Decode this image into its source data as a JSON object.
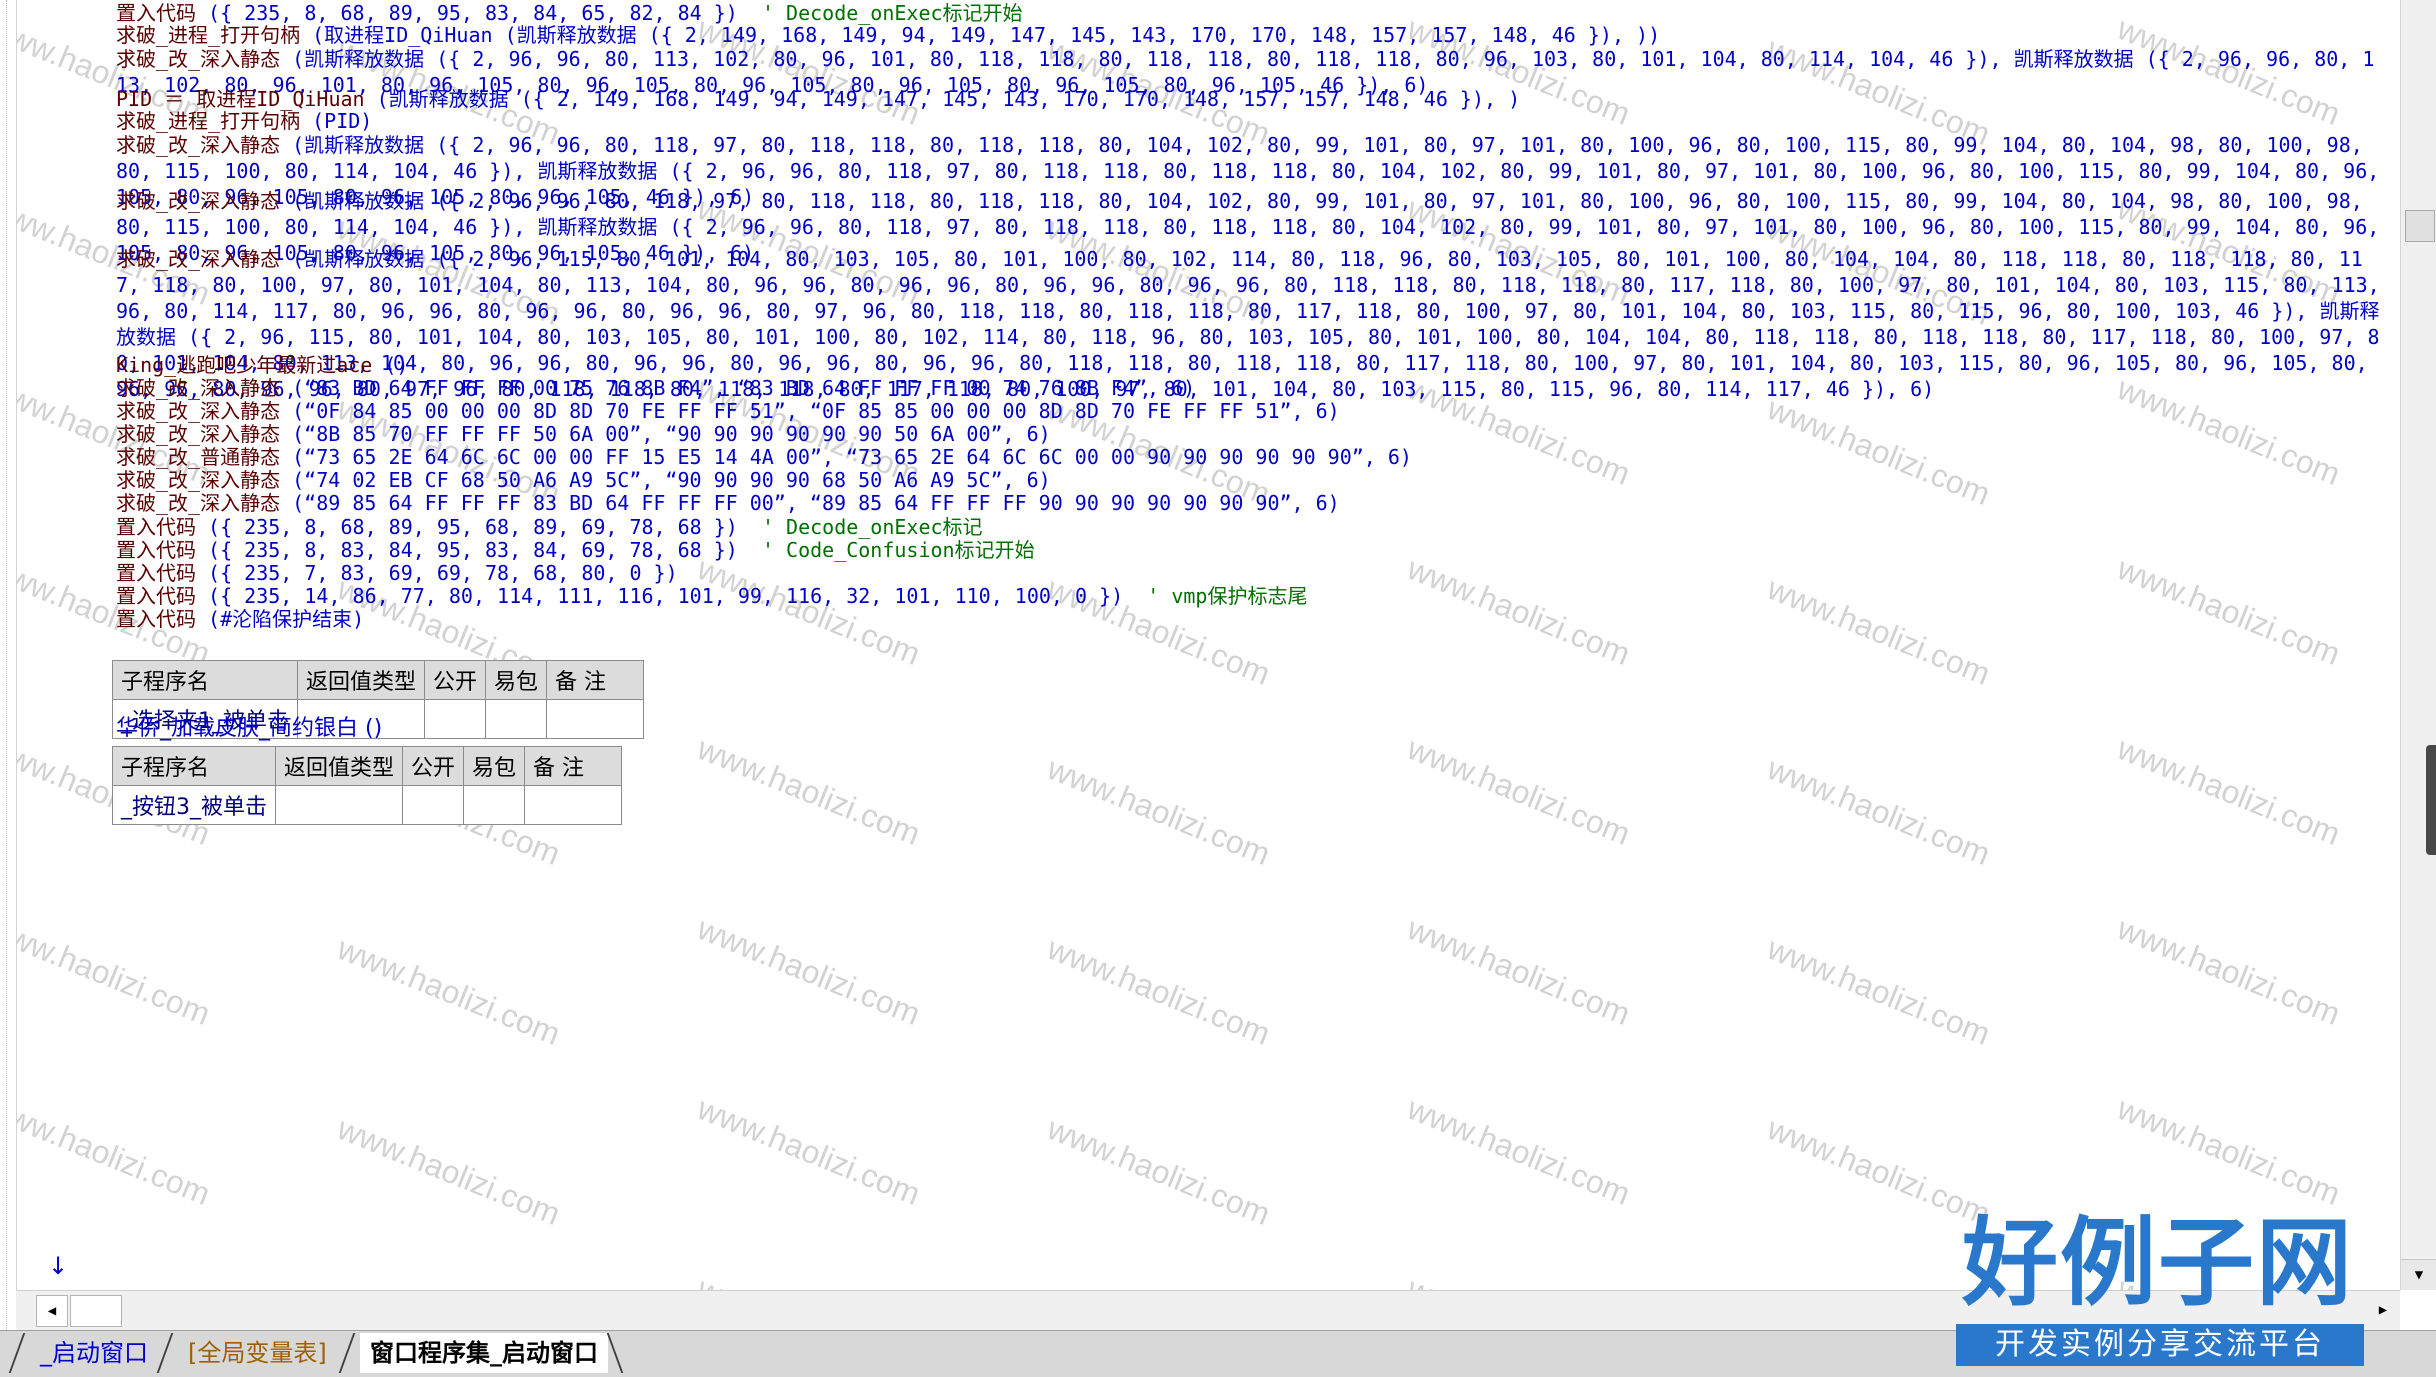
{
  "code_lines": [
    {
      "cmd": "置入代码",
      "args": " ({ 235, 8, 68, 89, 95, 83, 84, 65, 82, 84 })",
      "comment": "  ' Decode_onExec标记开始"
    },
    {
      "cmd": "求破_进程_打开句柄",
      "args": " (取进程ID_QiHuan (凯斯释放数据 ({ 2, 149, 168, 149, 94, 149, 147, 145, 143, 170, 170, 148, 157, 157, 148, 46 }), ))",
      "comment": ""
    },
    {
      "cmd": "求破_改_深入静态",
      "args": " (凯斯释放数据 ({ 2, 96, 96, 80, 113, 102, 80, 96, 101, 80, 118, 118, 80, 118, 118, 80, 118, 118, 80, 96, 103, 80, 101, 104, 80, 114, 104, 46 }), 凯斯释放数据 ({ 2, 96, 96, 80, 113, 102, 80, 96, 101, 80, 96, 105, 80, 96, 105, 80, 96, 105, 80, 96, 105, 80, 96, 105, 80, 96, 105, 46 }), 6)",
      "comment": ""
    },
    {
      "cmd": "PID ＝ 取进程ID_QiHuan",
      "args": " (凯斯释放数据 ({ 2, 149, 168, 149, 94, 149, 147, 145, 143, 170, 170, 148, 157, 157, 148, 46 }), )",
      "comment": ""
    },
    {
      "cmd": "求破_进程_打开句柄",
      "args": " (PID)",
      "comment": ""
    },
    {
      "cmd": "求破_改_深入静态",
      "args": " (凯斯释放数据 ({ 2, 96, 96, 80, 118, 97, 80, 118, 118, 80, 118, 118, 80, 104, 102, 80, 99, 101, 80, 97, 101, 80, 100, 96, 80, 100, 115, 80, 99, 104, 80, 104, 98, 80, 100, 98, 80, 115, 100, 80, 114, 104, 46 }), 凯斯释放数据 ({ 2, 96, 96, 80, 118, 97, 80, 118, 118, 80, 118, 118, 80, 104, 102, 80, 99, 101, 80, 97, 101, 80, 100, 96, 80, 100, 115, 80, 99, 104, 80, 96, 105, 80, 96, 105, 80, 96, 105, 80, 96, 105, 46 }), 6)",
      "comment": ""
    },
    {
      "cmd": "求破_改_深入静态",
      "args": " (凯斯释放数据 ({ 2, 96, 96, 80, 118, 97, 80, 118, 118, 80, 118, 118, 80, 104, 102, 80, 99, 101, 80, 97, 101, 80, 100, 96, 80, 100, 115, 80, 99, 104, 80, 104, 98, 80, 100, 98, 80, 115, 100, 80, 114, 104, 46 }), 凯斯释放数据 ({ 2, 96, 96, 80, 118, 97, 80, 118, 118, 80, 118, 118, 80, 104, 102, 80, 99, 101, 80, 97, 101, 80, 100, 96, 80, 100, 115, 80, 99, 104, 80, 96, 105, 80, 96, 105, 80, 96, 105, 80, 96, 105, 46 }), 6)",
      "comment": ""
    },
    {
      "cmd": "求破_改_深入静态",
      "args": " (凯斯释放数据 ({ 2, 96, 115, 80, 101, 104, 80, 103, 105, 80, 101, 100, 80, 102, 114, 80, 118, 96, 80, 103, 105, 80, 101, 100, 80, 104, 104, 80, 118, 118, 80, 118, 118, 80, 117, 118, 80, 100, 97, 80, 101, 104, 80, 113, 104, 80, 96, 96, 80, 96, 96, 80, 96, 96, 80, 96, 96, 80, 118, 118, 80, 118, 118, 80, 117, 118, 80, 100, 97, 80, 101, 104, 80, 103, 115, 80, 113, 96, 80, 114, 117, 80, 96, 96, 80, 96, 96, 80, 96, 96, 80, 97, 96, 80, 118, 118, 80, 118, 118, 80, 117, 118, 80, 100, 97, 80, 101, 104, 80, 103, 115, 80, 115, 96, 80, 100, 103, 46 }), 凯斯释放数据 ({ 2, 96, 115, 80, 101, 104, 80, 103, 105, 80, 101, 100, 80, 102, 114, 80, 118, 96, 80, 103, 105, 80, 101, 100, 80, 104, 104, 80, 118, 118, 80, 118, 118, 80, 117, 118, 80, 100, 97, 80, 101, 104, 80, 113, 104, 80, 96, 96, 80, 96, 96, 80, 96, 96, 80, 96, 96, 80, 118, 118, 80, 118, 118, 80, 117, 118, 80, 100, 97, 80, 101, 104, 80, 103, 115, 80, 96, 105, 80, 96, 105, 80, 96, 96, 80, 96, 96, 80, 97, 96, 80, 118, 118, 80, 118, 118, 80, 117, 118, 80, 100, 97, 80, 101, 104, 80, 103, 115, 80, 115, 96, 80, 114, 117, 46 }), 6)",
      "comment": ""
    },
    {
      "cmd": "King_逃跑吧少年最新过ace",
      "args": " ()",
      "comment": ""
    },
    {
      "cmd": "求破_改_深入静态",
      "args": " (“83 BD 64 FF FF FF 00 75 76 8B F4”, “83 BD 64 FF FF FF 00 74 76 8B F4”, 6)",
      "comment": ""
    },
    {
      "cmd": "求破_改_深入静态",
      "args": " (“0F 84 85 00 00 00 8D 8D 70 FE FF FF 51”, “0F 85 85 00 00 00 8D 8D 70 FE FF FF 51”, 6)",
      "comment": ""
    },
    {
      "cmd": "求破_改_深入静态",
      "args": " (“8B 85 70 FF FF FF 50 6A 00”, “90 90 90 90 90 90 50 6A 00”, 6)",
      "comment": ""
    },
    {
      "cmd": "求破_改_普通静态",
      "args": " (“73 65 2E 64 6C 6C 00 00 FF 15 E5 14 4A 00”, “73 65 2E 64 6C 6C 00 00 90 90 90 90 90 90”, 6)",
      "comment": ""
    },
    {
      "cmd": "求破_改_深入静态",
      "args": " (“74 02 EB CF 68 50 A6 A9 5C”, “90 90 90 90 68 50 A6 A9 5C”, 6)",
      "comment": ""
    },
    {
      "cmd": "求破_改_深入静态",
      "args": " (“89 85 64 FF FF FF 83 BD 64 FF FF FF 00”, “89 85 64 FF FF FF 90 90 90 90 90 90 90”, 6)",
      "comment": ""
    },
    {
      "cmd": "置入代码",
      "args": " ({ 235, 8, 68, 89, 95, 68, 89, 69, 78, 68 })",
      "comment": "  ' Decode_onExec标记"
    },
    {
      "cmd": "置入代码",
      "args": " ({ 235, 8, 83, 84, 95, 83, 84, 69, 78, 68 })",
      "comment": "  ' Code_Confusion标记开始"
    },
    {
      "cmd": "置入代码",
      "args": " ({ 235, 7, 83, 69, 69, 78, 68, 80, 0 })",
      "comment": ""
    },
    {
      "cmd": "置入代码",
      "args": " ({ 235, 14, 86, 77, 80, 114, 111, 116, 101, 99, 116, 32, 101, 110, 100, 0 })",
      "comment": "  ' vmp保护标志尾"
    },
    {
      "cmd": "置入代码",
      "args": " (#沦陷保护结束)",
      "comment": ""
    }
  ],
  "sub_tables": [
    {
      "headers": [
        "子程序名",
        "返回值类型",
        "公开",
        "易包",
        "备 注"
      ],
      "row": [
        "_选择夹1_被单击",
        "",
        "",
        "",
        ""
      ]
    },
    {
      "headers": [
        "子程序名",
        "返回值类型",
        "公开",
        "易包",
        "备 注"
      ],
      "row": [
        "_按钮3_被单击",
        "",
        "",
        "",
        ""
      ]
    }
  ],
  "between_tables_line": "华侨_加载皮肤_简约银白 ()",
  "fold_arrow": "↓",
  "watermark": "www.haolizi.com",
  "tabs": [
    "_启动窗口",
    "[全局变量表]",
    "窗口程序集_启动窗口"
  ],
  "brand": {
    "title": "好例子网",
    "subtitle": "开发实例分享交流平台"
  },
  "colors": {
    "code": "#0000c8",
    "command": "#5a0000",
    "comment": "#007000",
    "brand": "#2a78cc"
  },
  "scroll": {
    "left": "◀",
    "right": "▶",
    "down": "▼"
  }
}
